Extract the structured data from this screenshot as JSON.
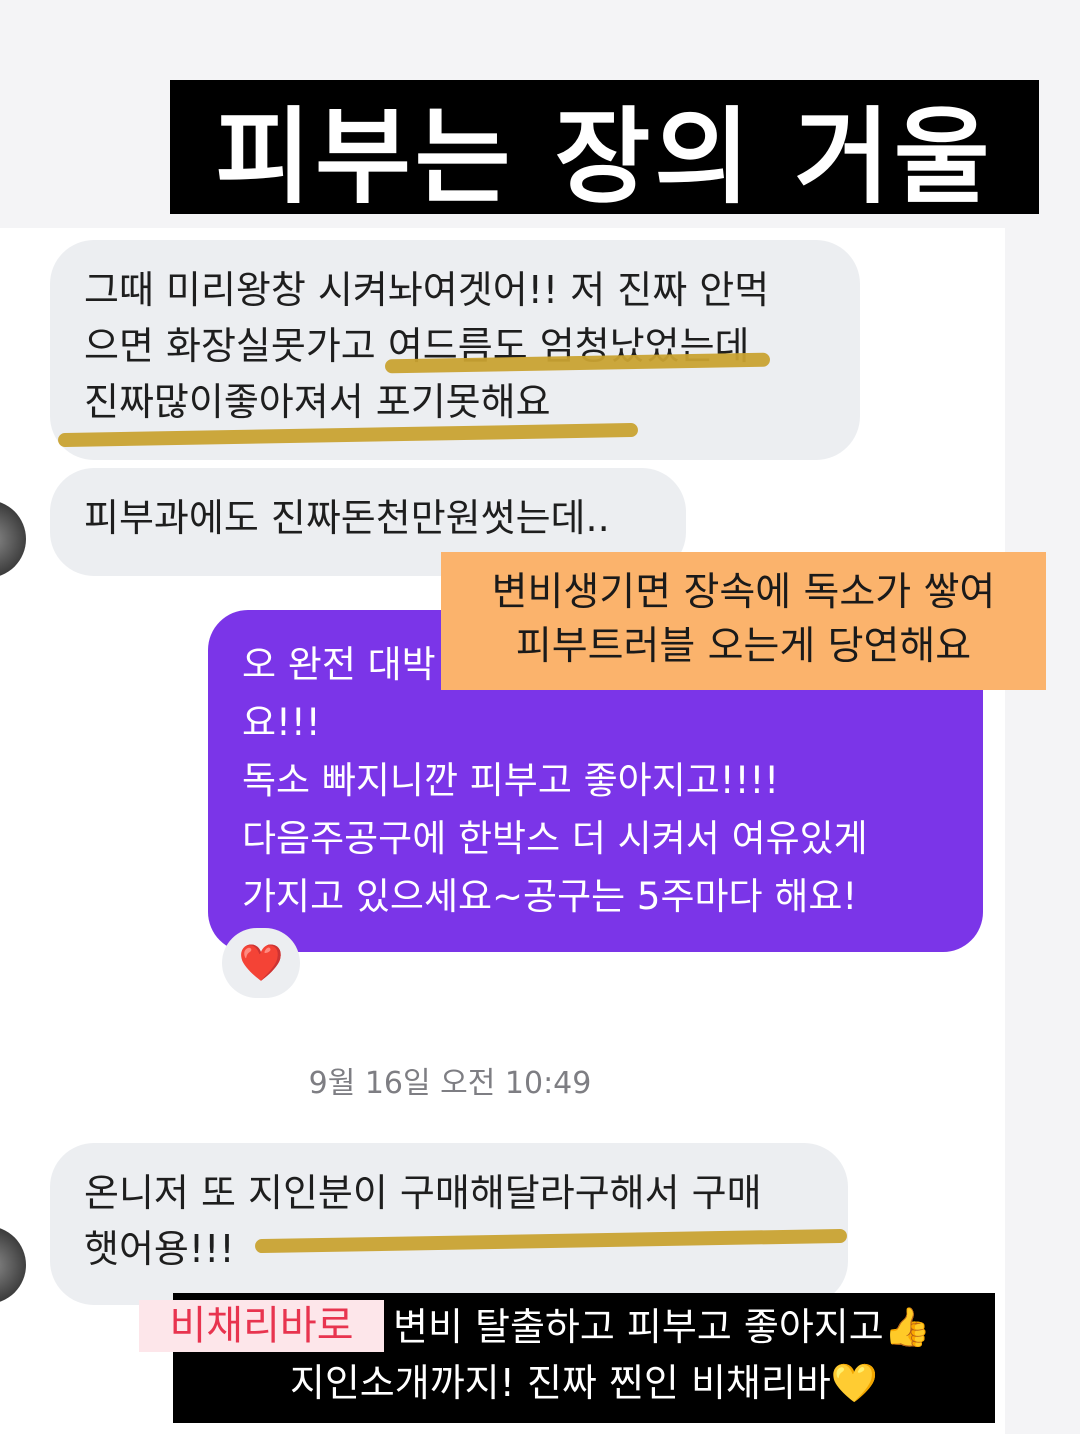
{
  "title_banner": "피부는 장의 거울",
  "messages": {
    "incoming_1": {
      "lines": [
        "그때 미리왕창 시켜놔여겟어!! 저  진짜 안먹",
        "으면 화장실못가고 여드름도 엄청났었는데",
        "진짜많이좋아져서 포기못해요"
      ]
    },
    "incoming_2": {
      "lines": [
        "피부과에도 진짜돈천만원썻는데.."
      ]
    },
    "outgoing_1": {
      "lines": [
        "오 완전 대박",
        "요!!!",
        "독소 빠지니깐 피부고 좋아지고!!!!",
        "다음주공구에 한박스 더 시켜서 여유있게",
        "가지고 있으세요~공구는 5주마다 해요!"
      ],
      "reaction": "❤️"
    },
    "timestamp": "9월 16일 오전 10:49",
    "incoming_3": {
      "lines": [
        "온니저 또 지인분이 구매해달라구해서 구매",
        "햇어용!!!"
      ]
    }
  },
  "orange_caption": {
    "lines": [
      "변비생기면 장속에 독소가 쌓여",
      "피부트러블 오는게 당연해요"
    ]
  },
  "bottom_banner": {
    "brand": "비채리바로",
    "line1": "변비 탈출하고 피부고 좋아지고",
    "line1_emoji": "👍",
    "line2": "지인소개까지! 진짜 찐인 비채리바",
    "line2_emoji": "💛"
  },
  "colors": {
    "outgoing_bubble": "#7b35e8",
    "incoming_bubble": "#eceef1",
    "highlight": "#c9a232",
    "caption": "#fbb36c",
    "brand_text": "#e8344f"
  }
}
